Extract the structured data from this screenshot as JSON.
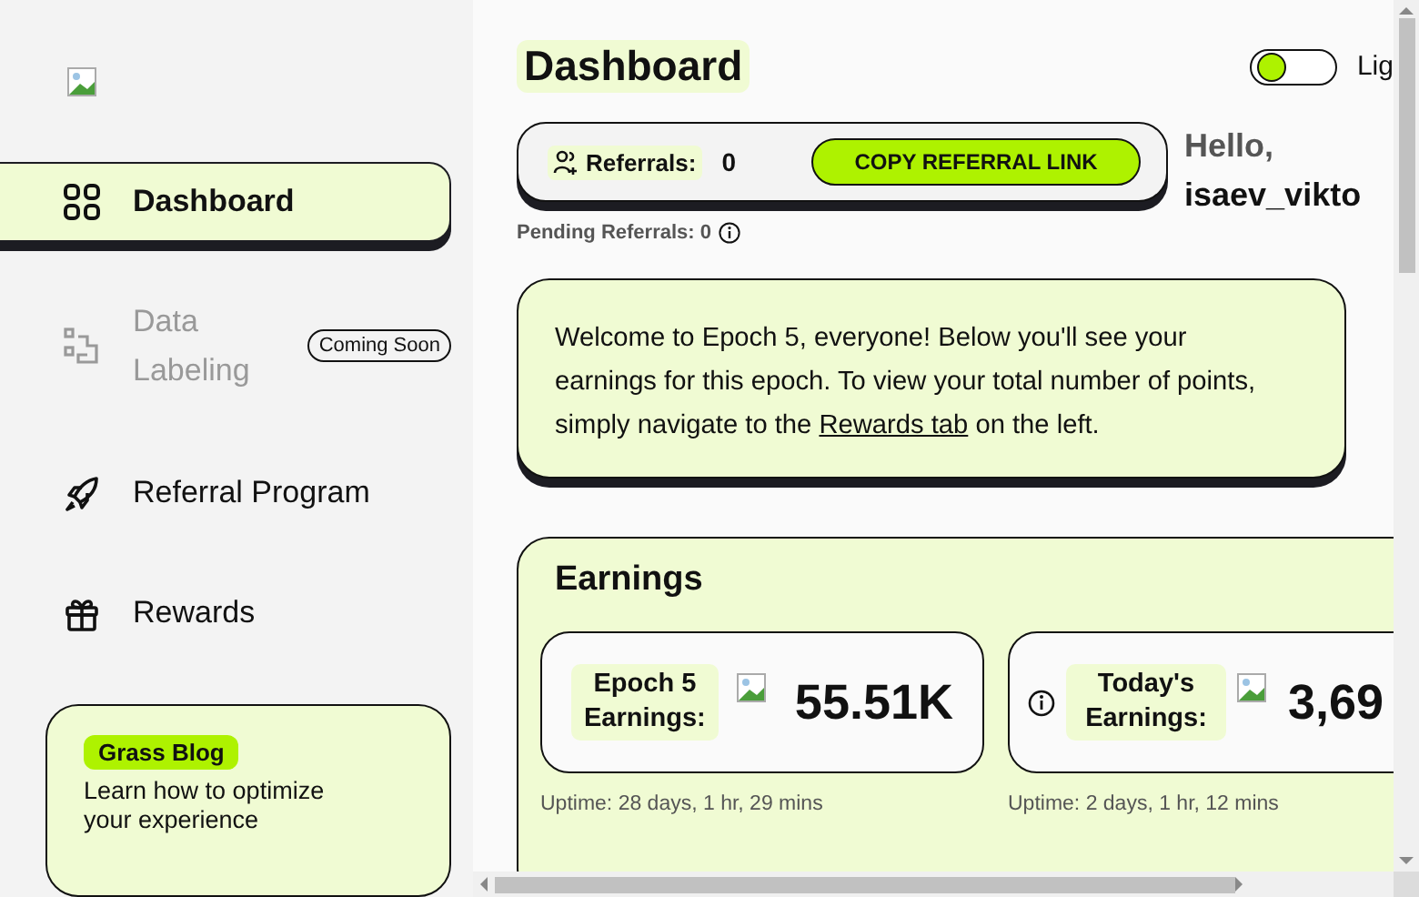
{
  "sidebar": {
    "items": [
      {
        "label": "Dashboard",
        "kind": "grid",
        "selected": true,
        "disabled": false
      },
      {
        "label": "Data Labeling",
        "kind": "steps",
        "selected": false,
        "disabled": true,
        "badge": "Coming Soon"
      },
      {
        "label": "Referral Program",
        "kind": "rocket",
        "selected": false,
        "disabled": false
      },
      {
        "label": "Rewards",
        "kind": "gift",
        "selected": false,
        "disabled": false
      }
    ],
    "blog_card": {
      "tag": "Grass Blog",
      "text": "Learn how to optimize your experience"
    }
  },
  "header": {
    "title": "Dashboard",
    "theme_toggle": {
      "on": false,
      "label": "Lig"
    }
  },
  "referrals": {
    "label": "Referrals:",
    "count": "0",
    "button": "COPY REFERRAL LINK",
    "pending": "Pending Referrals: 0"
  },
  "greeting": {
    "line1": "Hello,",
    "line2": "isaev_vikto"
  },
  "welcome": {
    "text": "Welcome to Epoch 5, everyone! Below you'll see your earnings for this epoch. To view your total number of points, simply navigate to the ",
    "link": "Rewards tab",
    "after": " on the left."
  },
  "earnings": {
    "title": "Earnings",
    "cards": [
      {
        "label": "Epoch 5 Earnings:",
        "value": "55.51K",
        "uptime": "Uptime: 28 days, 1 hr, 29 mins",
        "info": false
      },
      {
        "label": "Today's Earnings:",
        "value": "3,69",
        "uptime": "Uptime: 2 days, 1 hr, 12 mins",
        "info": true
      }
    ]
  }
}
